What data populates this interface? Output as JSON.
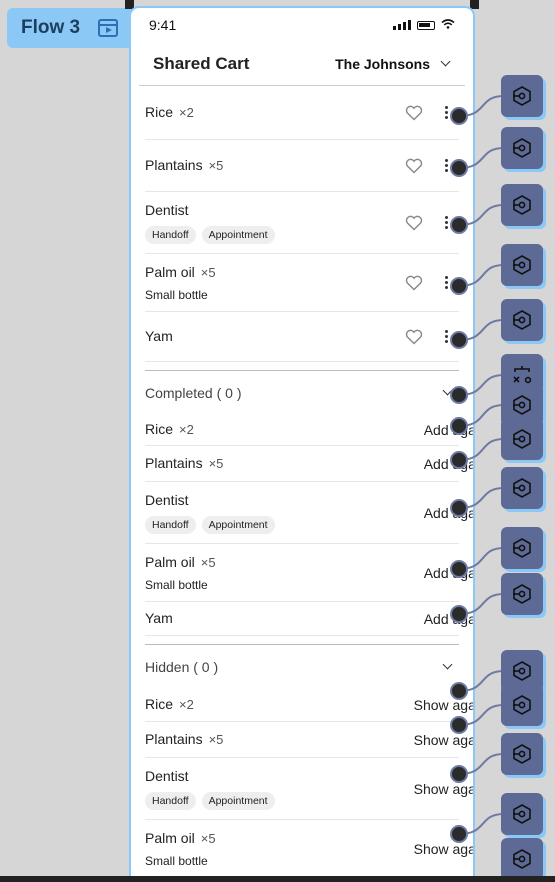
{
  "flow": {
    "label": "Flow 3"
  },
  "status": {
    "time": "9:41"
  },
  "header": {
    "title": "Shared Cart",
    "family": "The Johnsons"
  },
  "active_items": [
    {
      "name": "Rice",
      "qty": "×2",
      "note": "",
      "tags": []
    },
    {
      "name": "Plantains",
      "qty": "×5",
      "note": "",
      "tags": []
    },
    {
      "name": "Dentist",
      "qty": "",
      "note": "",
      "tags": [
        "Handoff",
        "Appointment"
      ]
    },
    {
      "name": "Palm oil",
      "qty": "×5",
      "note": "Small bottle",
      "tags": []
    },
    {
      "name": "Yam",
      "qty": "",
      "note": "",
      "tags": []
    }
  ],
  "completed": {
    "label": "Completed ( 0 )",
    "action": "Add agai",
    "items": [
      {
        "name": "Rice",
        "qty": "×2",
        "note": "",
        "tags": []
      },
      {
        "name": "Plantains",
        "qty": "×5",
        "note": "",
        "tags": []
      },
      {
        "name": "Dentist",
        "qty": "",
        "note": "",
        "tags": [
          "Handoff",
          "Appointment"
        ]
      },
      {
        "name": "Palm oil",
        "qty": "×5",
        "note": "Small bottle",
        "tags": []
      },
      {
        "name": "Yam",
        "qty": "",
        "note": "",
        "tags": []
      }
    ]
  },
  "hidden": {
    "label": "Hidden ( 0 )",
    "action": "Show agai",
    "items": [
      {
        "name": "Rice",
        "qty": "×2",
        "note": "",
        "tags": []
      },
      {
        "name": "Plantains",
        "qty": "×5",
        "note": "",
        "tags": []
      },
      {
        "name": "Dentist",
        "qty": "",
        "note": "",
        "tags": [
          "Handoff",
          "Appointment"
        ]
      },
      {
        "name": "Palm oil",
        "qty": "×5",
        "note": "Small bottle",
        "tags": []
      }
    ]
  },
  "colors": {
    "accent": "#8cc8f5",
    "node": "#5d6a95"
  }
}
